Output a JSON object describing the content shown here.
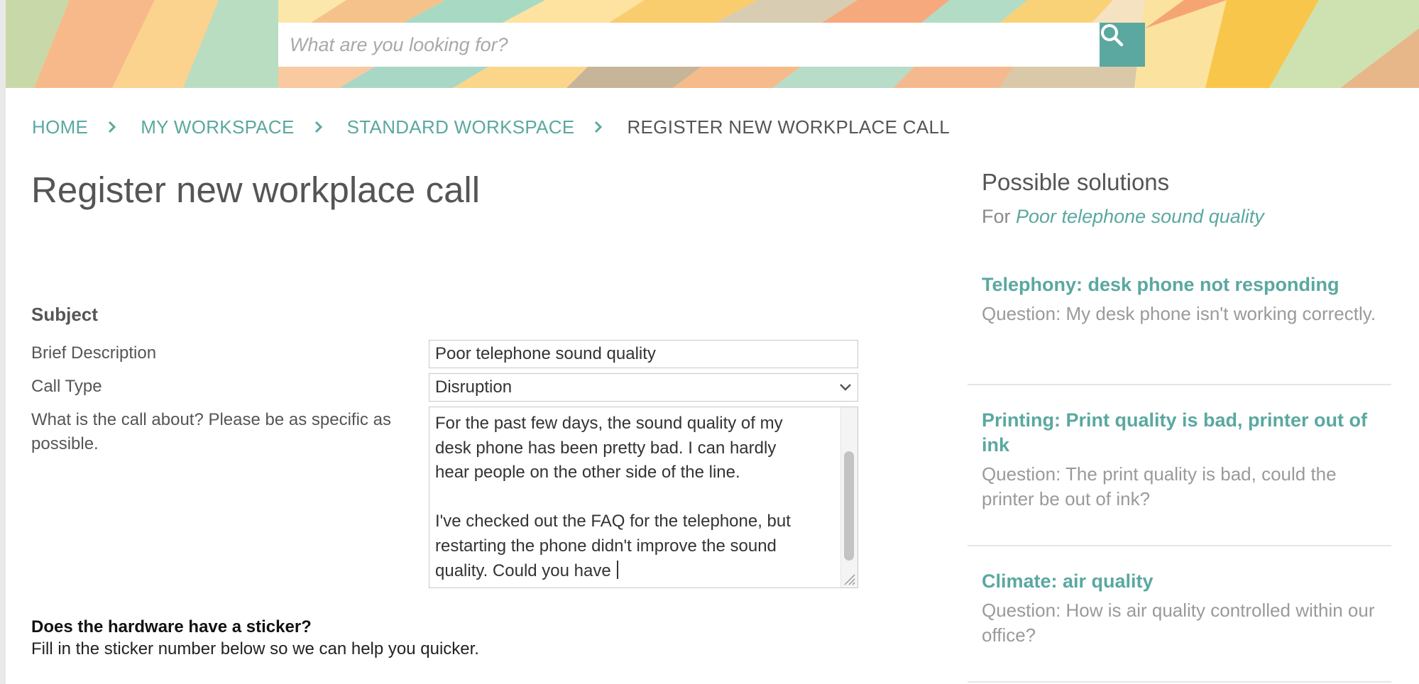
{
  "search": {
    "placeholder": "What are you looking for?",
    "button_icon": "search-icon"
  },
  "breadcrumb": {
    "items": [
      "HOME",
      "MY WORKSPACE",
      "STANDARD WORKSPACE"
    ],
    "current": "REGISTER NEW WORKPLACE CALL"
  },
  "page": {
    "title": "Register new workplace call"
  },
  "form": {
    "section_heading": "Subject",
    "brief_description_label": "Brief Description",
    "brief_description_value": "Poor telephone sound quality",
    "call_type_label": "Call Type",
    "call_type_value": "Disruption",
    "details_label": "What is the call about? Please be as specific as possible.",
    "details_value": "For the past few days, the sound quality of my\ndesk phone has been pretty bad. I can hardly\nhear people on the other side of the line.\n\nI've checked out the FAQ for the telephone, but\nrestarting the phone didn't improve the sound\nquality. Could you have ",
    "sticker_heading": "Does the hardware have a sticker?",
    "sticker_help": "Fill in the sticker number below so we can help you quicker."
  },
  "solutions": {
    "title": "Possible solutions",
    "for_prefix": "For ",
    "for_subject": "Poor telephone sound quality",
    "items": [
      {
        "title": "Telephony: desk phone not responding",
        "question": "Question:  My desk phone isn't working correctly."
      },
      {
        "title": "Printing: Print quality is bad, printer out of ink",
        "question": "Question: The print quality is bad, could the printer be out of ink?"
      },
      {
        "title": "Climate: air quality",
        "question": "Question: How is air quality controlled within our office?"
      }
    ]
  },
  "colors": {
    "accent": "#5aa8a0",
    "text": "#555555",
    "muted": "#9a9a9a"
  }
}
